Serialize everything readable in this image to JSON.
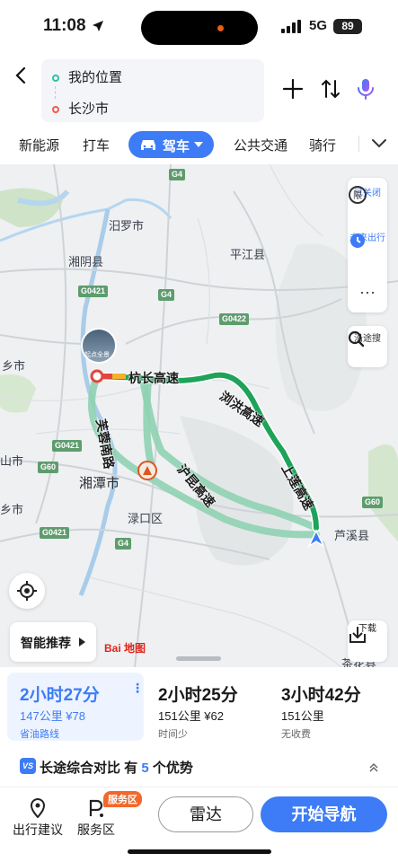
{
  "status_bar": {
    "time": "11:08",
    "network": "5G",
    "battery": "89"
  },
  "route": {
    "origin": "我的位置",
    "destination": "长沙市"
  },
  "tabs": {
    "items": [
      "新能源",
      "打车",
      "公共交通",
      "骑行"
    ],
    "active": "驾车"
  },
  "map": {
    "places": {
      "miluo": "汨罗市",
      "pingjiang": "平江县",
      "xiangyin": "湘阴县",
      "xiangtan": "湘潭市",
      "luzi": "渌口区",
      "luxi": "芦溪县",
      "xiang_l": "乡市",
      "shan_l": "山市",
      "xiang_l2": "乡市",
      "chaling": "茶花县"
    },
    "roads": [
      "G4",
      "G4",
      "G4",
      "G0421",
      "G0422",
      "G0421",
      "G60",
      "G0421",
      "G60",
      "G4"
    ],
    "highways": {
      "hang_chang": "杭长高速",
      "liu_hong": "浏洪高速",
      "shang_lian": "上莲高速",
      "fu_rong": "芙蓉南路",
      "hu_kun": "沪昆高速"
    },
    "landmark": "起点全景",
    "side_controls": {
      "restrict": "已关闭",
      "future": "未来出行",
      "along": "沿途搜",
      "download": "下载"
    },
    "smart_recommend": "智能推荐",
    "logo": "Bai 地图"
  },
  "route_options": [
    {
      "duration": "2小时27分",
      "distance": "147公里 ¥78",
      "tag": "省油路线",
      "selected": true
    },
    {
      "duration": "2小时25分",
      "distance": "151公里 ¥62",
      "tag": "时间少",
      "selected": false
    },
    {
      "duration": "3小时42分",
      "distance": "151公里",
      "tag": "无收费",
      "selected": false
    }
  ],
  "compare": {
    "prefix": "长途综合对比 有",
    "count": "5",
    "suffix": "个优势",
    "badge": "VS"
  },
  "bottom": {
    "advice": "出行建议",
    "service": "服务区",
    "service_badge": "服务区",
    "radar": "雷达",
    "start": "开始导航"
  },
  "colors": {
    "accent": "#3d7cf6",
    "route": "#1ea35a",
    "route_alt": "#8fd2b3"
  }
}
